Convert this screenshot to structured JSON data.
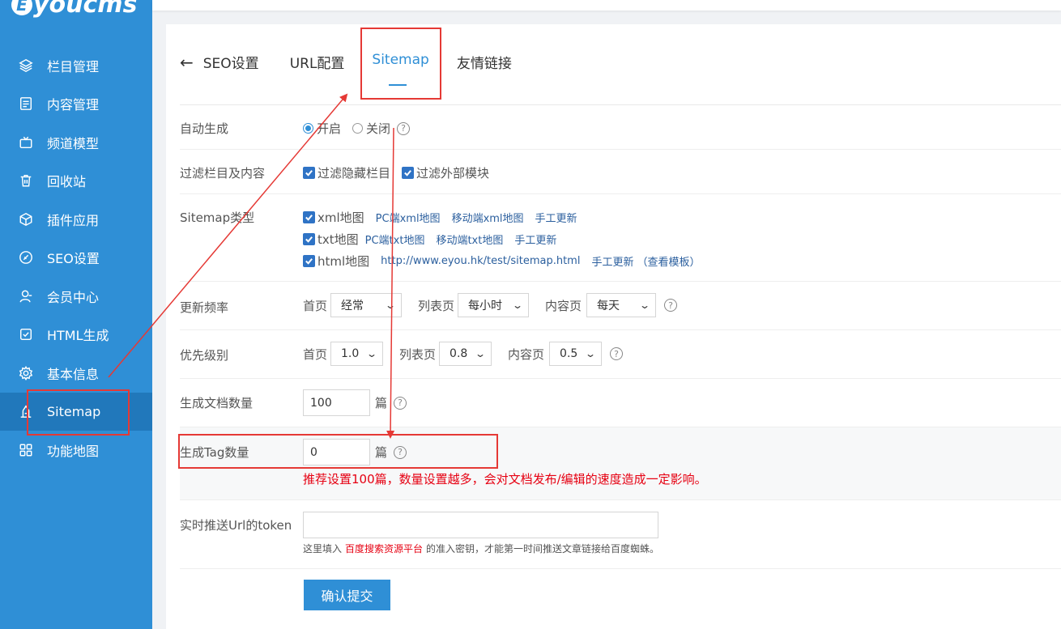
{
  "logo": {
    "text": "youcms",
    "mark": "E"
  },
  "sidebar": {
    "items": [
      {
        "label": "栏目管理",
        "icon": "layers-icon"
      },
      {
        "label": "内容管理",
        "icon": "document-icon"
      },
      {
        "label": "频道模型",
        "icon": "tv-icon"
      },
      {
        "label": "回收站",
        "icon": "trash-icon"
      },
      {
        "label": "插件应用",
        "icon": "cube-icon"
      },
      {
        "label": "SEO设置",
        "icon": "seo-icon"
      },
      {
        "label": "会员中心",
        "icon": "user-icon"
      },
      {
        "label": "HTML生成",
        "icon": "check-square-icon"
      },
      {
        "label": "基本信息",
        "icon": "gear-icon"
      },
      {
        "label": "Sitemap",
        "icon": "sitemap-icon",
        "active": true
      },
      {
        "label": "功能地图",
        "icon": "grid-icon"
      }
    ]
  },
  "tabs": {
    "back_label": "SEO设置",
    "items": [
      {
        "label": "URL配置"
      },
      {
        "label": "Sitemap",
        "active": true
      },
      {
        "label": "友情链接"
      }
    ]
  },
  "form": {
    "auto_generate": {
      "label": "自动生成",
      "on_label": "开启",
      "off_label": "关闭",
      "selected": "开启"
    },
    "filter": {
      "label": "过滤栏目及内容",
      "opt1": "过滤隐藏栏目",
      "opt2": "过滤外部模块"
    },
    "sitemap_type": {
      "label": "Sitemap类型",
      "xml": {
        "label": "xml地图",
        "link1": "PC端xml地图",
        "link2": "移动端xml地图",
        "link3": "手工更新"
      },
      "txt": {
        "label": "txt地图",
        "link1": "PC端txt地图",
        "link2": "移动端txt地图",
        "link3": "手工更新"
      },
      "html": {
        "label": "html地图",
        "link1": "http://www.eyou.hk/test/sitemap.html",
        "link2": "手工更新",
        "link3": "（查看模板）"
      }
    },
    "frequency": {
      "label": "更新频率",
      "home_label": "首页",
      "home_value": "经常",
      "list_label": "列表页",
      "list_value": "每小时",
      "content_label": "内容页",
      "content_value": "每天"
    },
    "priority": {
      "label": "优先级别",
      "home_label": "首页",
      "home_value": "1.0",
      "list_label": "列表页",
      "list_value": "0.8",
      "content_label": "内容页",
      "content_value": "0.5"
    },
    "doc_count": {
      "label": "生成文档数量",
      "value": "100",
      "unit": "篇"
    },
    "tag_count": {
      "label": "生成Tag数量",
      "value": "0",
      "unit": "篇",
      "warning": "推荐设置100篇，数量设置越多，会对文档发布/编辑的速度造成一定影响。"
    },
    "token": {
      "label": "实时推送Url的token",
      "value": "",
      "hint_before": "这里填入",
      "hint_link": "百度搜索资源平台",
      "hint_after": "的准入密钥，才能第一时间推送文章链接给百度蜘蛛。"
    },
    "submit_label": "确认提交"
  },
  "colors": {
    "sidebar": "#2f8fd6",
    "sidebar_active": "#2178bb",
    "accent": "#2f8fd6",
    "annotation": "#e53935",
    "warning": "#e60012"
  }
}
